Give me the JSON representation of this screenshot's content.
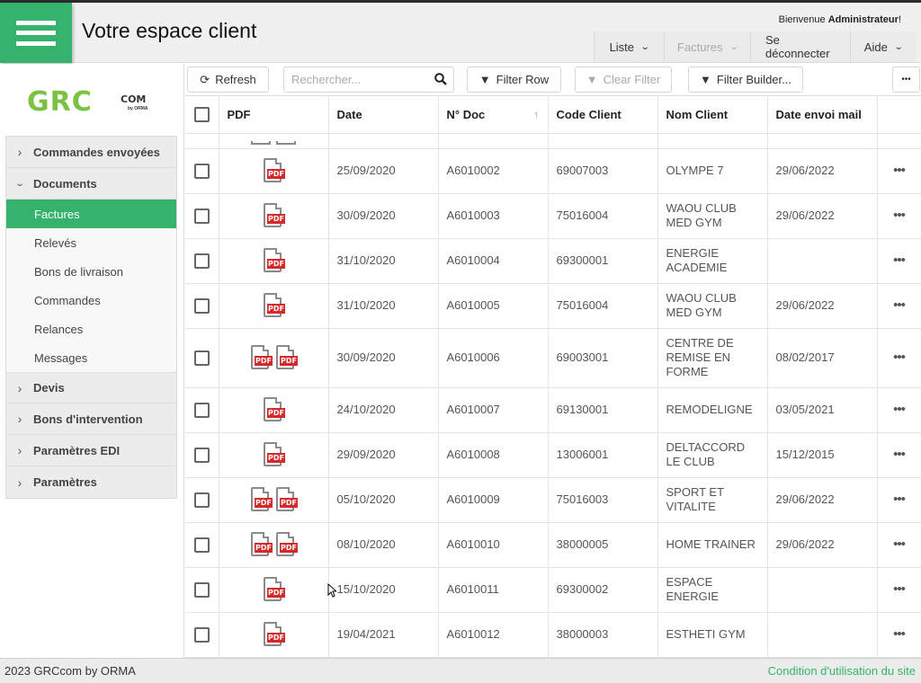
{
  "header": {
    "title": "Votre espace client",
    "welcome_prefix": "Bienvenue ",
    "welcome_user": "Administrateur",
    "welcome_suffix": "!",
    "nav": [
      {
        "label": "Liste",
        "dropdown": true,
        "disabled": false
      },
      {
        "label": "Factures",
        "dropdown": true,
        "disabled": true
      },
      {
        "label": "Se déconnecter",
        "dropdown": false,
        "disabled": false
      },
      {
        "label": "Aide",
        "dropdown": true,
        "disabled": false
      }
    ]
  },
  "logo": {
    "main": "GRC",
    "sub": "COM",
    "by": "by ORMA"
  },
  "sidebar": {
    "groups": [
      {
        "label": "Commandes envoyées",
        "expanded": false
      },
      {
        "label": "Documents",
        "expanded": true,
        "items": [
          {
            "label": "Factures",
            "active": true
          },
          {
            "label": "Relevés",
            "active": false
          },
          {
            "label": "Bons de livraison",
            "active": false
          },
          {
            "label": "Commandes",
            "active": false
          },
          {
            "label": "Relances",
            "active": false
          },
          {
            "label": "Messages",
            "active": false
          }
        ]
      },
      {
        "label": "Devis",
        "expanded": false
      },
      {
        "label": "Bons d'intervention",
        "expanded": false
      },
      {
        "label": "Paramètres EDI",
        "expanded": false
      },
      {
        "label": "Paramètres",
        "expanded": false
      }
    ]
  },
  "toolbar": {
    "refresh": "Refresh",
    "search_placeholder": "Rechercher...",
    "search_value": "",
    "filter_row": "Filter Row",
    "clear_filter": "Clear Filter",
    "filter_builder": "Filter Builder...",
    "more": "•••"
  },
  "table": {
    "columns": [
      "PDF",
      "Date",
      "N° Doc",
      "Code Client",
      "Nom Client",
      "Date envoi mail"
    ],
    "sorted_column": "N° Doc",
    "sort_direction": "asc",
    "pdf_label": "PDF",
    "row_action": "•••",
    "rows": [
      {
        "pdfs": 1,
        "date": "25/09/2020",
        "doc": "A6010002",
        "code": "69007003",
        "name": "OLYMPE 7",
        "mail": "29/06/2022"
      },
      {
        "pdfs": 1,
        "date": "30/09/2020",
        "doc": "A6010003",
        "code": "75016004",
        "name": "WAOU CLUB MED GYM",
        "mail": "29/06/2022"
      },
      {
        "pdfs": 1,
        "date": "31/10/2020",
        "doc": "A6010004",
        "code": "69300001",
        "name": "ENERGIE ACADEMIE",
        "mail": ""
      },
      {
        "pdfs": 1,
        "date": "31/10/2020",
        "doc": "A6010005",
        "code": "75016004",
        "name": "WAOU CLUB MED GYM",
        "mail": "29/06/2022"
      },
      {
        "pdfs": 2,
        "date": "30/09/2020",
        "doc": "A6010006",
        "code": "69003001",
        "name": "CENTRE DE REMISE EN FORME",
        "mail": "08/02/2017"
      },
      {
        "pdfs": 1,
        "date": "24/10/2020",
        "doc": "A6010007",
        "code": "69130001",
        "name": "REMODELIGNE",
        "mail": "03/05/2021"
      },
      {
        "pdfs": 1,
        "date": "29/09/2020",
        "doc": "A6010008",
        "code": "13006001",
        "name": "DELTACCORD LE CLUB",
        "mail": "15/12/2015"
      },
      {
        "pdfs": 2,
        "date": "05/10/2020",
        "doc": "A6010009",
        "code": "75016003",
        "name": "SPORT ET VITALITE",
        "mail": "29/06/2022"
      },
      {
        "pdfs": 2,
        "date": "08/10/2020",
        "doc": "A6010010",
        "code": "38000005",
        "name": "HOME TRAINER",
        "mail": "29/06/2022"
      },
      {
        "pdfs": 1,
        "date": "15/10/2020",
        "doc": "A6010011",
        "code": "69300002",
        "name": "ESPACE ENERGIE",
        "mail": ""
      },
      {
        "pdfs": 1,
        "date": "19/04/2021",
        "doc": "A6010012",
        "code": "38000003",
        "name": "ESTHETI GYM",
        "mail": ""
      }
    ]
  },
  "footer": {
    "copyright": "2023 GRCcom by ORMA",
    "terms": "Condition d'utilisation du site"
  },
  "colors": {
    "accent": "#35b26b",
    "logo_green": "#7cc242",
    "pdf_red": "#d62a2a"
  }
}
